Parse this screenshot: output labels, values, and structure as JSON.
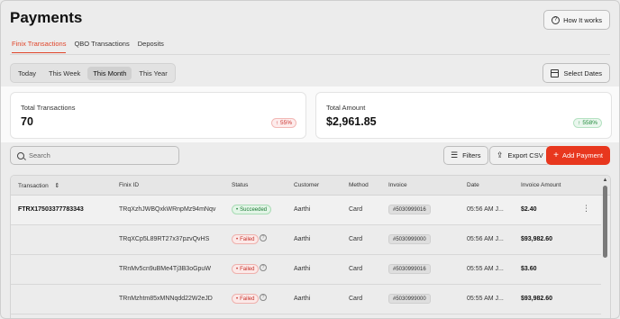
{
  "header": {
    "title": "Payments",
    "how_it_works": "How It works"
  },
  "tabs": [
    {
      "label": "Finix Transactions",
      "active": true
    },
    {
      "label": "QBO Transactions",
      "active": false
    },
    {
      "label": "Deposits",
      "active": false
    }
  ],
  "periods": [
    {
      "label": "Today"
    },
    {
      "label": "This Week"
    },
    {
      "label": "This Month",
      "active": true
    },
    {
      "label": "This Year"
    }
  ],
  "select_dates": "Select Dates",
  "stats": {
    "total_transactions": {
      "label": "Total Transactions",
      "value": "70",
      "change": "55%",
      "direction": "down"
    },
    "total_amount": {
      "label": "Total Amount",
      "value": "$2,961.85",
      "change": "558%",
      "direction": "up"
    }
  },
  "toolbar": {
    "search_placeholder": "Search",
    "filters": "Filters",
    "export": "Export CSV",
    "add_payment": "Add Payment"
  },
  "table": {
    "columns": [
      "Transaction",
      "Finix ID",
      "Status",
      "Customer",
      "Method",
      "Invoice",
      "Date",
      "Invoice Amount"
    ],
    "rows": [
      {
        "transaction": "FTRX17503377783343",
        "finix_id": "TRqXzhJWBQxkWRnpMz94mNqv",
        "status": "Succeeded",
        "customer": "Aarthi",
        "method": "Card",
        "invoice": "#5030999016",
        "date": "05:56 AM J...",
        "amount": "$2.40"
      },
      {
        "transaction": "",
        "finix_id": "TRqXCp5L89RT27x37pzvQvHS",
        "status": "Failed",
        "customer": "Aarthi",
        "method": "Card",
        "invoice": "#5030999000",
        "date": "05:56 AM J...",
        "amount": "$93,982.60"
      },
      {
        "transaction": "",
        "finix_id": "TRnMv5cn9uBMe4Tj3B3oGpuW",
        "status": "Failed",
        "customer": "Aarthi",
        "method": "Card",
        "invoice": "#5030999016",
        "date": "05:55 AM J...",
        "amount": "$3.60"
      },
      {
        "transaction": "",
        "finix_id": "TRnMzhtm85xMNNqdd22W2eJD",
        "status": "Failed",
        "customer": "Aarthi",
        "method": "Card",
        "invoice": "#5030999000",
        "date": "05:55 AM J...",
        "amount": "$93,982.60"
      }
    ]
  },
  "colors": {
    "accent": "#e8371e",
    "success": "#1c7a35",
    "failure": "#c62f28"
  }
}
